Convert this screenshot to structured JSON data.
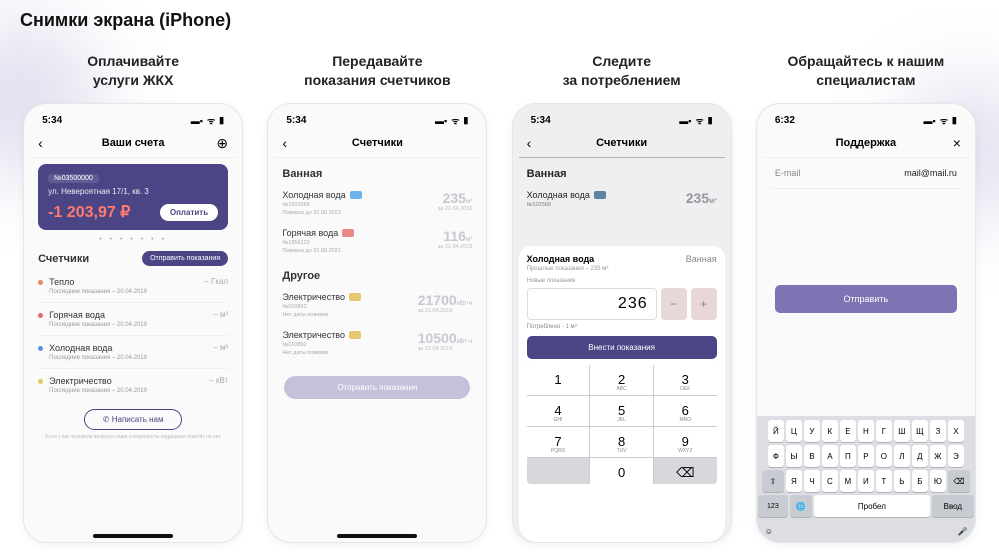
{
  "page_title": "Снимки экрана (iPhone)",
  "captions": [
    "Оплачивайте\nуслуги ЖКХ",
    "Передавайте\nпоказания счетчиков",
    "Следите\nза потреблением",
    "Обращайтесь к нашим\nспециалистам"
  ],
  "screen1": {
    "time": "5:34",
    "title": "Ваши счета",
    "account_no": "№03500000",
    "address": "ул. Невероятная 17/1, кв. 3",
    "amount": "-1 203,97 ₽",
    "pay": "Оплатить",
    "dots": "• • • • • • •",
    "counters": "Счетчики",
    "send_readings": "Отправить показания",
    "meters": [
      {
        "color": "#e58a5a",
        "name": "Тепло",
        "sub": "Последние показания – 20.04.2019",
        "unit": "– Гкал"
      },
      {
        "color": "#e56a6a",
        "name": "Горячая вода",
        "sub": "Последние показания – 20.04.2019",
        "unit": "– м³"
      },
      {
        "color": "#5a8fe5",
        "name": "Холодная вода",
        "sub": "Последние показания – 20.04.2019",
        "unit": "– м³"
      },
      {
        "color": "#e5c85a",
        "name": "Электричество",
        "sub": "Последние показания – 20.04.2019",
        "unit": "– кВт"
      }
    ],
    "write_us": "✆ Написать нам",
    "hint": "Если у вас возникли вопросы наши специалисты поддержки ответят на них"
  },
  "screen2": {
    "time": "5:34",
    "title": "Счетчики",
    "groups": [
      {
        "title": "Ванная",
        "items": [
          {
            "name": "Холодная вода",
            "icon": "#6fb2e8",
            "no": "№1602568",
            "check": "Поверка до 31.08.2023",
            "value": "235",
            "unit": "м³",
            "date": "за 21.04.2019"
          },
          {
            "name": "Горячая вода",
            "icon": "#e88a8a",
            "no": "№1856122",
            "check": "Поверка до 31.08.2021",
            "value": "116",
            "unit": "м³",
            "date": "за 21.04.2019"
          }
        ]
      },
      {
        "title": "Другое",
        "items": [
          {
            "name": "Электричество",
            "icon": "#e8c86f",
            "no": "№010892",
            "check": "Нет даты поверки",
            "value": "21700",
            "unit": "кВт·ч",
            "date": "за 21.04.2019"
          },
          {
            "name": "Электричество",
            "icon": "#e8c86f",
            "no": "№010892",
            "check": "Нет даты поверки",
            "value": "10500",
            "unit": "кВт·ч",
            "date": "за 21.04.2019"
          }
        ]
      }
    ],
    "send": "Отправить показания"
  },
  "screen3": {
    "time": "5:34",
    "title": "Счетчики",
    "bg_group": "Ванная",
    "bg_item": {
      "name": "Холодная вода",
      "no": "№102568",
      "value": "235",
      "unit": "м³"
    },
    "sheet_title": "Холодная вода",
    "sheet_room": "Ванная",
    "prev": "Прошлые показания – 235 м³",
    "new_label": "Новые показания",
    "input_value": "236",
    "consumed": "Потреблено - 1 м³",
    "submit": "Внести показания",
    "keypad": [
      [
        "1",
        ""
      ],
      [
        "2",
        "ABC"
      ],
      [
        "3",
        "DEF"
      ],
      [
        "4",
        "GHI"
      ],
      [
        "5",
        "JKL"
      ],
      [
        "6",
        "MNO"
      ],
      [
        "7",
        "PQRS"
      ],
      [
        "8",
        "TUV"
      ],
      [
        "9",
        "WXYZ"
      ],
      [
        "",
        ""
      ],
      [
        "0",
        ""
      ],
      [
        "⌫",
        ""
      ]
    ]
  },
  "screen4": {
    "time": "6:32",
    "title": "Поддержка",
    "email_label": "E-mail",
    "email_value": "mail@mail.ru",
    "send": "Отправить",
    "kb_rows": [
      [
        "Й",
        "Ц",
        "У",
        "К",
        "Е",
        "Н",
        "Г",
        "Ш",
        "Щ",
        "З",
        "Х"
      ],
      [
        "Ф",
        "Ы",
        "В",
        "А",
        "П",
        "Р",
        "О",
        "Л",
        "Д",
        "Ж",
        "Э"
      ],
      [
        "Я",
        "Ч",
        "С",
        "М",
        "И",
        "Т",
        "Ь",
        "Б",
        "Ю"
      ]
    ],
    "kb_123": "123",
    "kb_space": "Пробел",
    "kb_enter": "Ввод"
  }
}
